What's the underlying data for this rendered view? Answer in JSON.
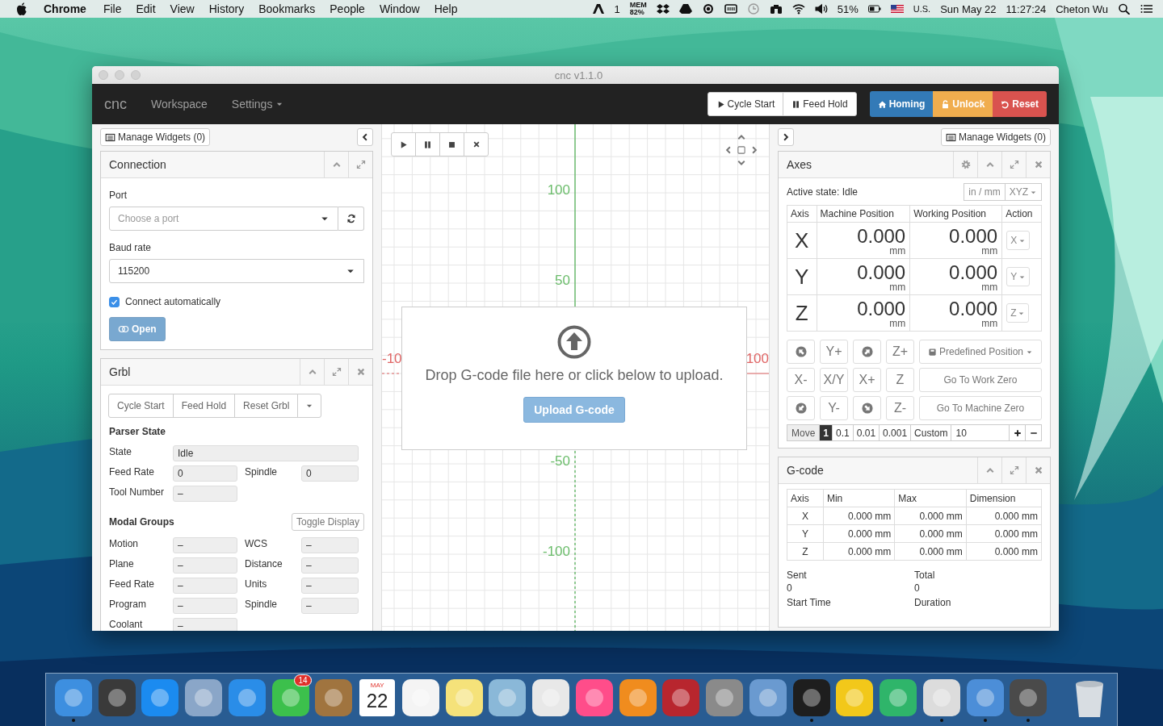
{
  "menubar": {
    "app": "Chrome",
    "menus": [
      "File",
      "Edit",
      "View",
      "History",
      "Bookmarks",
      "People",
      "Window",
      "Help"
    ],
    "adobe_count": "1",
    "mem_label": "MEM",
    "mem_value": "82%",
    "battery": "51%",
    "input_source": "U.S.",
    "date": "Sun May 22",
    "time": "11:27:24",
    "user": "Cheton Wu"
  },
  "window": {
    "title": "cnc v1.1.0"
  },
  "navbar": {
    "brand": "cnc",
    "items": [
      {
        "label": "Workspace",
        "kind": "link"
      },
      {
        "label": "Settings",
        "kind": "dropdown"
      }
    ],
    "controls": [
      {
        "label": "Cycle Start",
        "kind": "play"
      },
      {
        "label": "Feed Hold",
        "kind": "pause"
      }
    ],
    "actions": [
      {
        "label": "Homing",
        "kind": "home",
        "color": "#337ab7"
      },
      {
        "label": "Unlock",
        "kind": "unlock",
        "color": "#f0ad4e"
      },
      {
        "label": "Reset",
        "kind": "undo",
        "color": "#d9534f"
      }
    ]
  },
  "left_sidebar": {
    "manage_widgets": "Manage Widgets (0)"
  },
  "connection": {
    "title": "Connection",
    "port_label": "Port",
    "port_placeholder": "Choose a port",
    "baud_label": "Baud rate",
    "baud_value": "115200",
    "auto_connect": {
      "label": "Connect automatically",
      "checked": true
    },
    "open_button": {
      "label": "Open",
      "disabled": true
    }
  },
  "grbl": {
    "title": "Grbl",
    "buttons": [
      "Cycle Start",
      "Feed Hold",
      "Reset Grbl"
    ],
    "parser_title": "Parser State",
    "parser_fields": [
      {
        "label": "State",
        "value": "Idle",
        "kind": "wide"
      },
      {
        "label": "Feed Rate",
        "value": "0",
        "kind": "half"
      },
      {
        "label": "Spindle",
        "value": "0",
        "kind": "half"
      },
      {
        "label": "Tool Number",
        "value": "–",
        "kind": "half"
      }
    ],
    "modal_title": "Modal Groups",
    "toggle": "Toggle Display",
    "modal_fields": [
      {
        "label": "Motion",
        "value": "–"
      },
      {
        "label": "WCS",
        "value": "–"
      },
      {
        "label": "Plane",
        "value": "–"
      },
      {
        "label": "Distance",
        "value": "–"
      },
      {
        "label": "Feed Rate",
        "value": "–"
      },
      {
        "label": "Units",
        "value": "–"
      },
      {
        "label": "Program",
        "value": "–"
      },
      {
        "label": "Spindle",
        "value": "–"
      },
      {
        "label": "Coolant",
        "value": "–"
      }
    ]
  },
  "visualizer": {
    "y_labels": [
      "100",
      "50",
      "-50",
      "-100"
    ],
    "x_labels": [
      "-10",
      "100"
    ],
    "drop_message": "Drop G-code file here or click below to upload.",
    "upload_button": "Upload G-code"
  },
  "right_sidebar": {
    "manage_widgets": "Manage Widgets (0)"
  },
  "axes": {
    "title": "Axes",
    "active_state": "Active state: Idle",
    "units_button": "in / mm",
    "axes_button": "XYZ",
    "columns": [
      "Axis",
      "Machine Position",
      "Working Position",
      "Action"
    ],
    "rows": [
      {
        "axis": "X",
        "machine": "0.000",
        "machine_unit": "mm",
        "working": "0.000",
        "working_unit": "mm",
        "action": "X"
      },
      {
        "axis": "Y",
        "machine": "0.000",
        "machine_unit": "mm",
        "working": "0.000",
        "working_unit": "mm",
        "action": "Y"
      },
      {
        "axis": "Z",
        "machine": "0.000",
        "machine_unit": "mm",
        "working": "0.000",
        "working_unit": "mm",
        "action": "Z"
      }
    ],
    "jog": [
      {
        "kind": "arrow_nw"
      },
      {
        "kind": "text",
        "label": "Y+"
      },
      {
        "kind": "arrow_ne"
      },
      {
        "kind": "text",
        "label": "Z+"
      },
      {
        "kind": "text",
        "label": "X-"
      },
      {
        "kind": "text",
        "label": "X/Y"
      },
      {
        "kind": "text",
        "label": "X+"
      },
      {
        "kind": "text",
        "label": "Z"
      },
      {
        "kind": "arrow_sw"
      },
      {
        "kind": "text",
        "label": "Y-"
      },
      {
        "kind": "arrow_se"
      },
      {
        "kind": "text",
        "label": "Z-"
      }
    ],
    "predefined": "Predefined Position",
    "go_work_zero": "Go To Work Zero",
    "go_machine_zero": "Go To Machine Zero",
    "move_label": "Move",
    "steps": [
      {
        "label": "1",
        "selected": true
      },
      {
        "label": "0.1",
        "selected": false
      },
      {
        "label": "0.01",
        "selected": false
      },
      {
        "label": "0.001",
        "selected": false
      },
      {
        "label": "Custom",
        "selected": false
      }
    ],
    "custom_value": "10"
  },
  "gcode": {
    "title": "G-code",
    "columns": [
      "Axis",
      "Min",
      "Max",
      "Dimension"
    ],
    "rows": [
      [
        "X",
        "0.000 mm",
        "0.000 mm",
        "0.000 mm"
      ],
      [
        "Y",
        "0.000 mm",
        "0.000 mm",
        "0.000 mm"
      ],
      [
        "Z",
        "0.000 mm",
        "0.000 mm",
        "0.000 mm"
      ]
    ],
    "stats": [
      {
        "label": "Sent",
        "value": "0"
      },
      {
        "label": "Total",
        "value": "0"
      },
      {
        "label": "Start Time"
      },
      {
        "label": "Duration"
      }
    ]
  },
  "dock": {
    "items": [
      {
        "kind": "app",
        "color": "#3d8fe0",
        "running": true
      },
      {
        "kind": "app",
        "color": "#3a3a3a",
        "running": false
      },
      {
        "kind": "app",
        "color": "#1b8bf0",
        "running": false
      },
      {
        "kind": "app",
        "color": "#8aa6c8",
        "running": false
      },
      {
        "kind": "app",
        "color": "#2a8de8",
        "running": false
      },
      {
        "kind": "app",
        "color": "#3cc04c",
        "running": false,
        "badge": "14"
      },
      {
        "kind": "app",
        "color": "#a0743f",
        "running": false
      },
      {
        "kind": "calendar",
        "month": "MAY",
        "day": "22",
        "running": false
      },
      {
        "kind": "app",
        "color": "#f4f4f4",
        "running": false
      },
      {
        "kind": "app",
        "color": "#f5e27a",
        "running": false
      },
      {
        "kind": "app",
        "color": "#8ab8d8",
        "running": false
      },
      {
        "kind": "app",
        "color": "#e8e8e8",
        "running": false
      },
      {
        "kind": "app",
        "color": "#ff4d8a",
        "running": false
      },
      {
        "kind": "app",
        "color": "#f08c1e",
        "running": false
      },
      {
        "kind": "app",
        "color": "#b8262e",
        "running": false
      },
      {
        "kind": "app",
        "color": "#8a8a8a",
        "running": false
      },
      {
        "kind": "app",
        "color": "#6a9ad0",
        "running": false
      },
      {
        "kind": "app",
        "color": "#1e1e1e",
        "running": true
      },
      {
        "kind": "app",
        "color": "#f2c81a",
        "running": false
      },
      {
        "kind": "app",
        "color": "#2fb56a",
        "running": false
      },
      {
        "kind": "app",
        "color": "#dcdcdc",
        "running": true
      },
      {
        "kind": "app",
        "color": "#4c8ed8",
        "running": true
      },
      {
        "kind": "app",
        "color": "#4a4a4a",
        "running": true
      },
      {
        "kind": "trash",
        "running": false
      }
    ]
  }
}
